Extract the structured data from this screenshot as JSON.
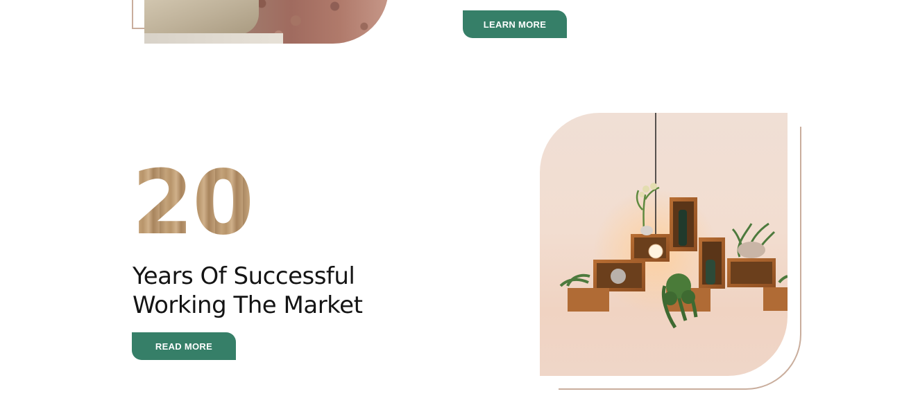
{
  "top_section": {
    "learn_more_label": "LEARN MORE"
  },
  "stats": {
    "years_number": "20",
    "headline_line1": "Years Of Successful",
    "headline_line2": "Working The Market",
    "read_more_label": "READ MORE"
  },
  "colors": {
    "accent_green": "#367f68",
    "frame_tan": "#c9ad9c",
    "wood": "#b8956b"
  },
  "icons": {
    "hanging_bulb": "bulb-icon"
  }
}
